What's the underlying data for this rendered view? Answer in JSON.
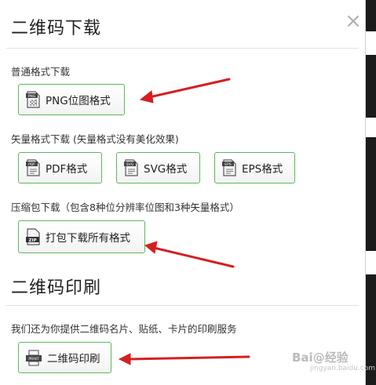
{
  "dialog": {
    "title": "二维码下载",
    "close_label": "×"
  },
  "sections": {
    "normal": {
      "label": "普通格式下载",
      "png_button": "PNG位图格式",
      "png_icon_text": "PNG"
    },
    "vector": {
      "label": "矢量格式下载 (矢量格式没有美化效果)",
      "pdf_button": "PDF格式",
      "pdf_icon_text": "PDF",
      "svg_button": "SVG格式",
      "svg_icon_text": "SVG",
      "eps_button": "EPS格式",
      "eps_icon_text": "EPS"
    },
    "zip": {
      "label": "压缩包下载（包含8种位分辨率位图和3种矢量格式）",
      "zip_button": "打包下载所有格式",
      "zip_icon_text": "ZIP"
    },
    "print": {
      "heading": "二维码印刷",
      "label": "我们还为你提供二维码名片、贴纸、卡片的印刷服务",
      "print_button": "二维码印刷",
      "print_icon_text": "PRINT"
    }
  },
  "watermark": {
    "text": "Bai@经验",
    "sub": "jingyan.baidu.com"
  },
  "colors": {
    "button_border": "#5cb85c",
    "arrow": "#d42020"
  }
}
